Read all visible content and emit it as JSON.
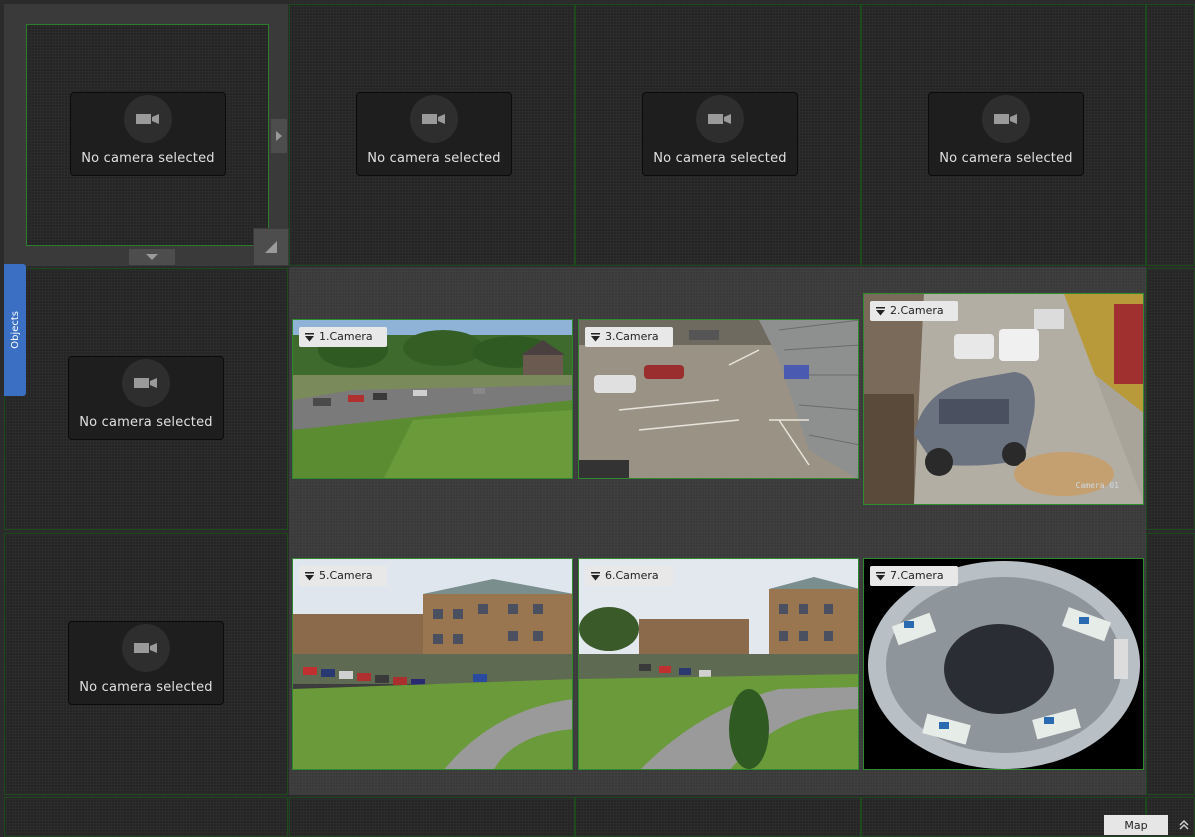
{
  "placeholder_text": "No camera selected",
  "objects_tab_label": "Objects",
  "map_button_label": "Map",
  "colors": {
    "cell_border": "#1d4a1d",
    "feed_border": "#2f8a2f",
    "objects_tab": "#3a6fc4"
  },
  "cameras": [
    {
      "label": "1.Camera"
    },
    {
      "label": "3.Camera"
    },
    {
      "label": "2.Camera",
      "overlay": "Camera 01"
    },
    {
      "label": "5.Camera"
    },
    {
      "label": "6.Camera"
    },
    {
      "label": "7.Camera"
    }
  ],
  "icons": {
    "camera": "video-camera-icon",
    "dropdown": "triangle-down-icon",
    "resize": "resize-corner-icon",
    "expand": "chevron-up-icon"
  }
}
